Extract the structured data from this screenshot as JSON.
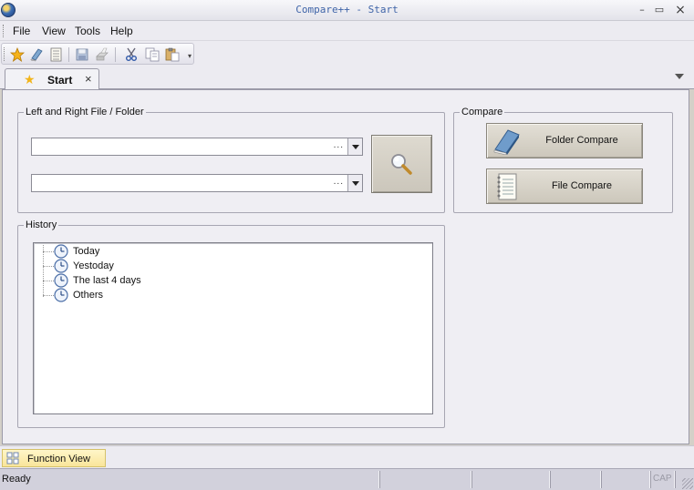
{
  "window": {
    "title": "Compare++ - Start",
    "controls": {
      "minimize": "–",
      "maximize": "▭",
      "close": "×"
    }
  },
  "menu": {
    "items": [
      "File",
      "View",
      "Tools",
      "Help"
    ]
  },
  "toolbar": {
    "buttons": [
      "favorites-star-icon",
      "folder-compare-book-icon",
      "file-compare-notebook-icon",
      "save-icon",
      "print-icon",
      "cut-icon",
      "copy-icon",
      "paste-icon"
    ]
  },
  "tabs": [
    {
      "label": "Start",
      "close": "×"
    }
  ],
  "left_right": {
    "legend": "Left and Right File / Folder",
    "left_path": "",
    "right_path": "",
    "browse_dots": "..."
  },
  "compare": {
    "legend": "Compare",
    "folder_button": "Folder Compare",
    "file_button": "File Compare"
  },
  "history": {
    "legend": "History",
    "items": [
      "Today",
      "Yestoday",
      "The last 4 days",
      "Others"
    ]
  },
  "bottom_panel": {
    "label": "Function View"
  },
  "status": {
    "text": "Ready",
    "cap": "CAP"
  },
  "colors": {
    "accent": "#3f64a8",
    "panel": "#efeef3",
    "function_tab": "#f9e59a"
  }
}
